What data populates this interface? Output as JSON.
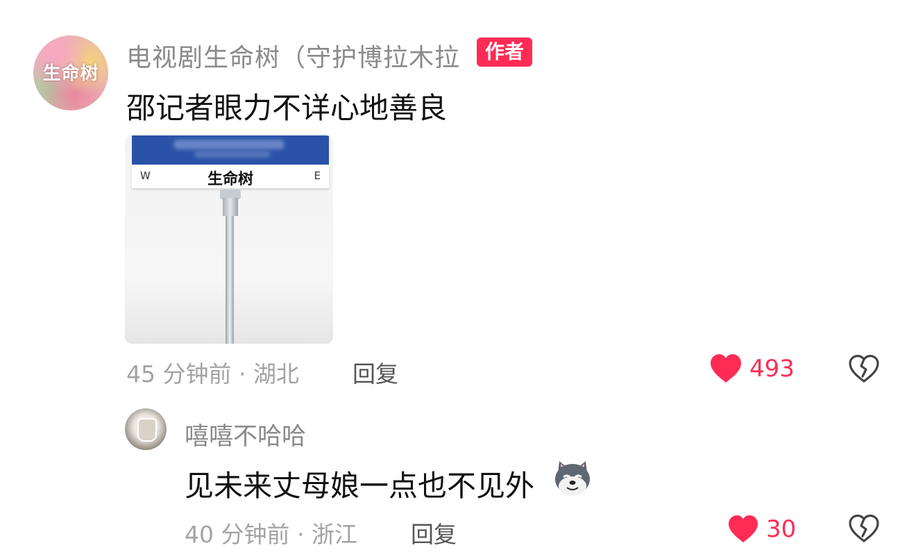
{
  "comment": {
    "avatar_text": "生命树",
    "username": "电视剧生命树（守护博拉木拉",
    "author_badge": "作者",
    "text": "邵记者眼力不详心地善良",
    "image": {
      "sign_title": "生命树",
      "sign_left": "W",
      "sign_right": "E"
    },
    "time_location": "45 分钟前 · 湖北",
    "reply_label": "回复",
    "like_count": "493",
    "like_icon": "heart-icon",
    "dislike_icon": "broken-heart-icon"
  },
  "reply": {
    "username": "嘻嘻不哈哈",
    "text": "见未来丈母娘一点也不见外",
    "emoji": "wolf-emoji",
    "time_location": "40 分钟前 · 浙江",
    "reply_label": "回复",
    "like_count": "30",
    "like_icon": "heart-icon",
    "dislike_icon": "broken-heart-icon"
  },
  "colors": {
    "accent": "#fe2c55",
    "meta_text": "#a3a3a3"
  }
}
